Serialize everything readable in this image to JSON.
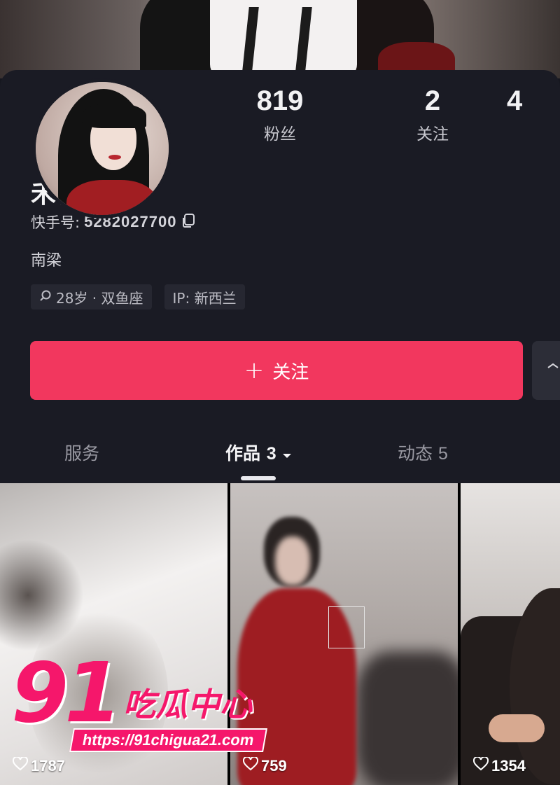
{
  "profile": {
    "display_name": "禾官",
    "kuaishou_id_label": "快手号:",
    "kuaishou_id": "5282027700",
    "location": "南梁",
    "tags": [
      "28岁 · 双鱼座",
      "IP: 新西兰"
    ]
  },
  "stats": [
    {
      "value": "819",
      "label": "粉丝"
    },
    {
      "value": "2",
      "label": "关注"
    },
    {
      "value": "4",
      "label": ""
    }
  ],
  "actions": {
    "follow_label": "关注",
    "follow_icon": "plus-icon"
  },
  "tabs": [
    {
      "label": "服务",
      "count": ""
    },
    {
      "label": "作品",
      "count": "3"
    },
    {
      "label": "动态",
      "count": "5"
    }
  ],
  "videos": [
    {
      "likes": "1787"
    },
    {
      "likes": "759"
    },
    {
      "likes": "1354"
    }
  ],
  "watermark": {
    "number": "91",
    "text": "吃瓜中心",
    "url": "https://91chigua21.com"
  },
  "colors": {
    "accent": "#f2375e",
    "background": "#1a1b24",
    "watermark": "#f5176b"
  }
}
